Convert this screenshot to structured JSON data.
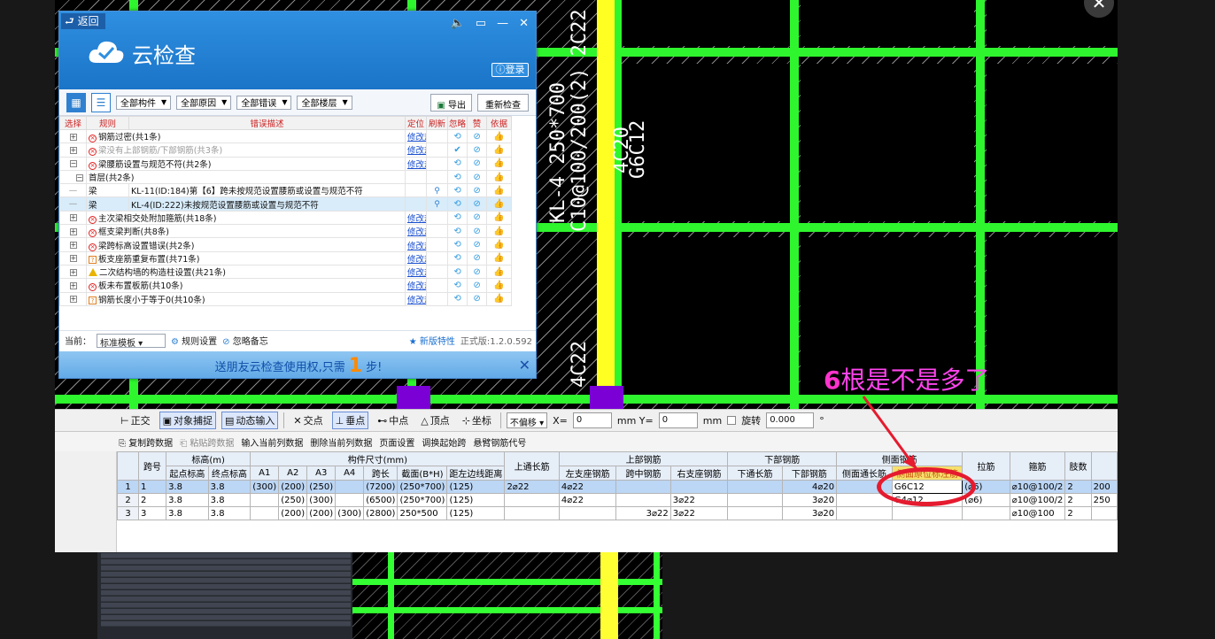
{
  "cad": {
    "label_beam1": "KL-4 250*700",
    "label_beam2": "C10@100/200(2) 2C22",
    "label_top": "4C20",
    "label_side": "G6C12",
    "label_bottom": "4C22",
    "annotation_first": "6",
    "annotation_rest": "根是不是多了"
  },
  "panel": {
    "back_label": "返回",
    "title": "云检查",
    "login_label": "登录",
    "filters": [
      "全部构件",
      "全部原因",
      "全部错误",
      "全部楼层"
    ],
    "export_label": "导出",
    "recheck_label": "重新检查",
    "columns": [
      "选择",
      "规则",
      "错误描述",
      "定位",
      "刷新",
      "忽略",
      "赞",
      "依据"
    ],
    "link_text": "修改规则模板",
    "basis_text": "依据",
    "rows": [
      {
        "desc": "钢筋过密(共1条)",
        "icon": "error",
        "grey": false,
        "level": 0
      },
      {
        "desc": "梁没有上部钢筋/下部钢筋(共3条)",
        "icon": "error",
        "grey": true,
        "level": 0
      },
      {
        "desc": "梁腰筋设置与规范不符(共2条)",
        "icon": "error",
        "grey": false,
        "level": 0
      },
      {
        "desc": "首层(共2条)",
        "icon": "",
        "grey": false,
        "level": 1
      },
      {
        "desc": "KL-11(ID:184)第【6】跨未按规范设置腰筋或设置与规范不符",
        "type": "梁",
        "icon": "",
        "grey": false,
        "level": 2
      },
      {
        "desc": "KL-4(ID:222)未按规范设置腰筋或设置与规范不符",
        "type": "梁",
        "icon": "",
        "grey": false,
        "level": 2
      },
      {
        "desc": "主次梁相交处附加箍筋(共18条)",
        "icon": "error",
        "grey": false,
        "level": 0
      },
      {
        "desc": "框支梁判断(共8条)",
        "icon": "error",
        "grey": false,
        "level": 0
      },
      {
        "desc": "梁跨标高设置错误(共2条)",
        "icon": "error",
        "grey": false,
        "level": 0
      },
      {
        "desc": "板支座筋重复布置(共71条)",
        "icon": "question",
        "grey": false,
        "level": 0
      },
      {
        "desc": "二次结构墙的构造柱设置(共21条)",
        "icon": "warning",
        "grey": false,
        "level": 0
      },
      {
        "desc": "板未布置板筋(共10条)",
        "icon": "error",
        "grey": false,
        "level": 0
      },
      {
        "desc": "钢筋长度小于等于0(共10条)",
        "icon": "question",
        "grey": false,
        "level": 0
      }
    ],
    "status_current_label": "当前：",
    "status_template": "标准模板",
    "rule_settings": "规则设置",
    "ignore_notes": "忽略备忘",
    "new_features": "新版特性",
    "version": "正式版:1.2.0.592",
    "banner_pre": "送朋友云检查使用权,只需",
    "banner_num": "1",
    "banner_post": "步!"
  },
  "snapbar": {
    "items": [
      "正交",
      "对象捕捉",
      "动态输入",
      "交点",
      "垂点",
      "中点",
      "顶点",
      "坐标"
    ],
    "offset_select": "不偏移",
    "x_label": "X=",
    "x_value": "0",
    "y_label": "mm Y=",
    "y_value": "0",
    "mm": "mm",
    "rotate_label": "旋转",
    "rotate_value": "0.000",
    "deg": "°"
  },
  "gridbar": {
    "items": [
      "复制跨数据",
      "粘贴跨数据",
      "输入当前列数据",
      "删除当前列数据",
      "页面设置",
      "调换起始跨",
      "悬臂钢筋代号"
    ]
  },
  "table": {
    "head1": {
      "span": "跨号",
      "elev": "标高(m)",
      "size": "构件尺寸(mm)",
      "top_long": "上通长筋",
      "top_bar": "上部钢筋",
      "bot_bar": "下部钢筋",
      "side_bar": "侧面钢筋",
      "stirrup": "箍筋",
      "legs": "肢数"
    },
    "head2": {
      "start": "起点标高",
      "end": "终点标高",
      "a1": "A1",
      "a2": "A2",
      "a3": "A3",
      "a4": "A4",
      "span_len": "跨长",
      "section": "截面(B*H)",
      "edge": "距左边线距离",
      "left_seat": "左支座钢筋",
      "mid": "跨中钢筋",
      "right_seat": "右支座钢筋",
      "bot_long": "下通长筋",
      "bot": "下部钢筋",
      "side_long": "侧面通长筋",
      "side_mark": "侧面原位标注筋",
      "tie": "拉筋"
    },
    "rows": [
      {
        "rn": "1",
        "span": "1",
        "start": "3.8",
        "end": "3.8",
        "a1": "(300)",
        "a2": "(200)",
        "a3": "(250)",
        "a4": "",
        "len": "(7200)",
        "sec": "(250*700)",
        "edge": "(125)",
        "top_long": "2⌀22",
        "left": "4⌀22",
        "mid": "",
        "right": "",
        "bot_long": "",
        "bot": "4⌀20",
        "side_long": "",
        "side_mark": "G6C12",
        "tie": "(⌀6)",
        "stirrup": "⌀10@100/2",
        "legs": "2",
        "extra": "200"
      },
      {
        "rn": "2",
        "span": "2",
        "start": "3.8",
        "end": "3.8",
        "a1": "",
        "a2": "(250)",
        "a3": "(300)",
        "a4": "",
        "len": "(6500)",
        "sec": "(250*700)",
        "edge": "(125)",
        "top_long": "",
        "left": "4⌀22",
        "mid": "",
        "right": "3⌀22",
        "bot_long": "",
        "bot": "3⌀20",
        "side_long": "",
        "side_mark": "G4⌀12",
        "tie": "(⌀6)",
        "stirrup": "⌀10@100/2",
        "legs": "2",
        "extra": "250"
      },
      {
        "rn": "3",
        "span": "3",
        "start": "3.8",
        "end": "3.8",
        "a1": "",
        "a2": "(200)",
        "a3": "(200)",
        "a4": "(300)",
        "len": "(2800)",
        "sec": "250*500",
        "edge": "(125)",
        "top_long": "",
        "left": "",
        "mid": "3⌀22",
        "right": "3⌀22",
        "bot_long": "",
        "bot": "3⌀20",
        "side_long": "",
        "side_mark": "",
        "tie": "",
        "stirrup": "⌀10@100",
        "legs": "2",
        "extra": ""
      }
    ]
  }
}
